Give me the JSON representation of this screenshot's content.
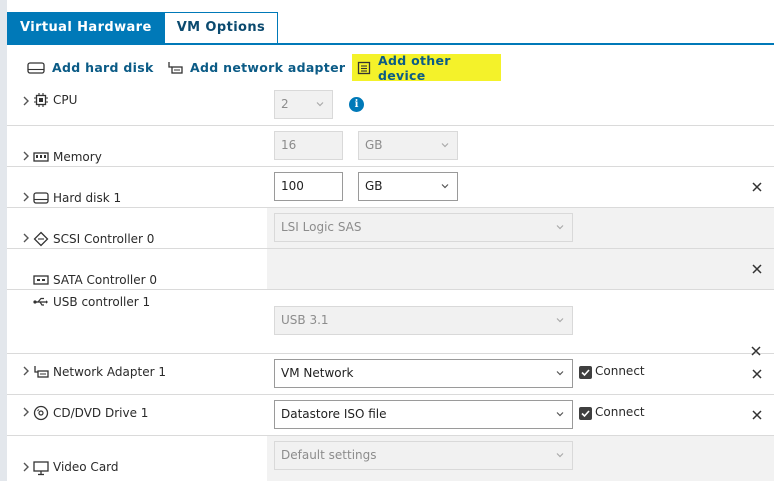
{
  "tabs": [
    {
      "label": "Virtual Hardware",
      "active": true
    },
    {
      "label": "VM Options",
      "active": false
    }
  ],
  "toolbar": {
    "add_hard_disk": "Add hard disk",
    "add_network_adapter": "Add network adapter",
    "add_other_device": "Add other device",
    "highlight_color": "#f4f22a"
  },
  "devices": {
    "cpu": {
      "label": "CPU",
      "value": "2"
    },
    "memory": {
      "label": "Memory",
      "value": "16",
      "unit": "GB"
    },
    "hard_disk_1": {
      "label": "Hard disk 1",
      "value": "100",
      "unit": "GB"
    },
    "scsi_controller_0": {
      "label": "SCSI Controller 0",
      "value": "LSI Logic SAS"
    },
    "sata_controller_0": {
      "label": "SATA Controller 0"
    },
    "usb_controller_1": {
      "label": "USB controller 1",
      "value": "USB 3.1"
    },
    "network_adapter_1": {
      "label": "Network Adapter 1",
      "value": "VM Network",
      "connect_label": "Connect",
      "connected": true
    },
    "cd_dvd_drive_1": {
      "label": "CD/DVD Drive 1",
      "value": "Datastore ISO file",
      "connect_label": "Connect",
      "connected": true
    },
    "video_card": {
      "label": "Video Card",
      "value": "Default settings"
    }
  },
  "colors": {
    "accent": "#0079b8",
    "link": "#0b5b86"
  }
}
